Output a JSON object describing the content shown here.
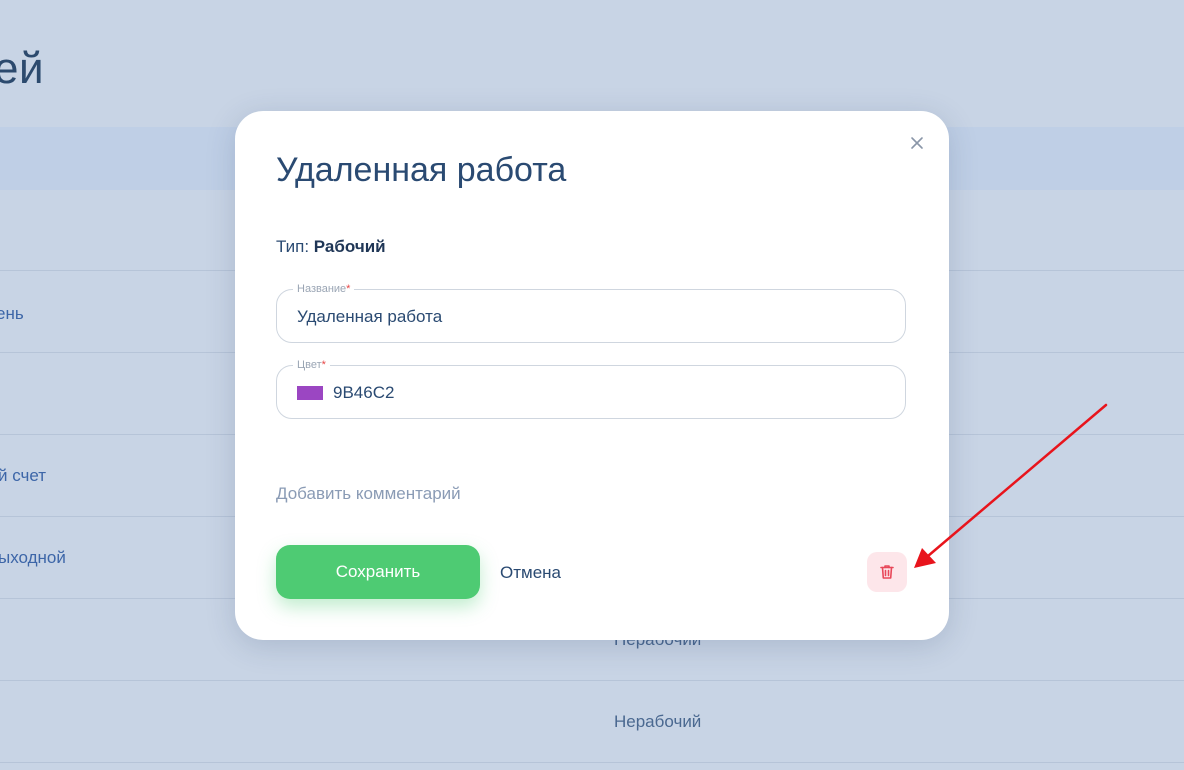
{
  "background": {
    "title_fragment": "ей",
    "rows": [
      {
        "name": "ень",
        "type": ""
      },
      {
        "name": "й счет",
        "type": ""
      },
      {
        "name": "ыходной",
        "type": ""
      },
      {
        "name": "",
        "type": "Нерабочий"
      },
      {
        "name": "",
        "type": "Нерабочий"
      }
    ]
  },
  "modal": {
    "title": "Удаленная работа",
    "type_label": "Тип:",
    "type_value": "Рабочий",
    "name_field": {
      "label": "Название",
      "required_mark": "*",
      "value": "Удаленная работа"
    },
    "color_field": {
      "label": "Цвет",
      "required_mark": "*",
      "value": "9B46C2",
      "swatch_color": "#9B46C2"
    },
    "add_comment": "Добавить комментарий",
    "save_label": "Сохранить",
    "cancel_label": "Отмена",
    "close_icon": "close-icon",
    "delete_icon": "trash-icon"
  },
  "colors": {
    "accent_green": "#4ECB73",
    "delete_bg": "#FDE6EA",
    "delete_icon": "#E8485A",
    "arrow": "#E8141C"
  }
}
